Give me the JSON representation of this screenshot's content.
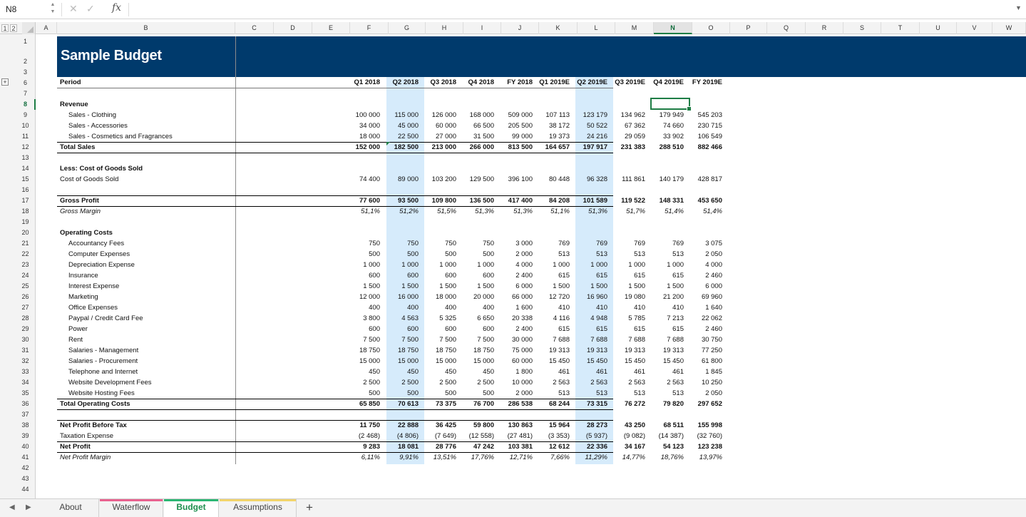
{
  "formula_bar": {
    "name_box": "N8",
    "formula": "",
    "fx": "fx",
    "cancel": "✕",
    "confirm": "✓"
  },
  "outline_levels": [
    "1",
    "2"
  ],
  "columns": [
    "A",
    "B",
    "C",
    "D",
    "E",
    "F",
    "G",
    "H",
    "I",
    "J",
    "K",
    "L",
    "M",
    "N",
    "O",
    "P",
    "Q",
    "R",
    "S",
    "T",
    "U",
    "V",
    "W"
  ],
  "active_column": "N",
  "rows": [
    "1",
    "2",
    "3",
    "6",
    "7",
    "8",
    "9",
    "10",
    "11",
    "12",
    "13",
    "14",
    "15",
    "16",
    "17",
    "18",
    "19",
    "20",
    "21",
    "22",
    "23",
    "24",
    "25",
    "26",
    "27",
    "28",
    "29",
    "30",
    "31",
    "32",
    "33",
    "34",
    "35",
    "36",
    "37",
    "38",
    "39",
    "40",
    "41",
    "42",
    "43",
    "44"
  ],
  "active_row": "8",
  "sheet": {
    "title": "Sample Budget",
    "period_label": "Period",
    "periods": [
      "Q1 2018",
      "Q2 2018",
      "Q3 2018",
      "Q4 2018",
      "FY 2018",
      "Q1 2019E",
      "Q2 2019E",
      "Q3 2019E",
      "Q4 2019E",
      "FY 2019E"
    ],
    "lines": [
      {
        "row": "8",
        "label": "Revenue",
        "bold": true
      },
      {
        "row": "9",
        "label": "Sales - Clothing",
        "indent": true,
        "values": [
          "100 000",
          "115 000",
          "126 000",
          "168 000",
          "509 000",
          "107 113",
          "123 179",
          "134 962",
          "179 949",
          "545 203"
        ]
      },
      {
        "row": "10",
        "label": "Sales - Accessories",
        "indent": true,
        "values": [
          "34 000",
          "45 000",
          "60 000",
          "66 500",
          "205 500",
          "38 172",
          "50 522",
          "67 362",
          "74 660",
          "230 715"
        ]
      },
      {
        "row": "11",
        "label": "Sales - Cosmetics and Fragrances",
        "indent": true,
        "values": [
          "18 000",
          "22 500",
          "27 000",
          "31 500",
          "99 000",
          "19 373",
          "24 216",
          "29 059",
          "33 902",
          "106 549"
        ]
      },
      {
        "row": "12",
        "label": "Total Sales",
        "bold": true,
        "values": [
          "152 000",
          "182 500",
          "213 000",
          "266 000",
          "813 500",
          "164 657",
          "197 917",
          "231 383",
          "288 510",
          "882 466"
        ]
      },
      {
        "row": "14",
        "label": "Less: Cost of Goods Sold",
        "bold": true
      },
      {
        "row": "15",
        "label": "Cost of Goods Sold",
        "values": [
          "74 400",
          "89 000",
          "103 200",
          "129 500",
          "396 100",
          "80 448",
          "96 328",
          "111 861",
          "140 179",
          "428 817"
        ]
      },
      {
        "row": "17",
        "label": "Gross Profit",
        "bold": true,
        "values": [
          "77 600",
          "93 500",
          "109 800",
          "136 500",
          "417 400",
          "84 208",
          "101 589",
          "119 522",
          "148 331",
          "453 650"
        ]
      },
      {
        "row": "18",
        "label": "Gross Margin",
        "italic": true,
        "values": [
          "51,1%",
          "51,2%",
          "51,5%",
          "51,3%",
          "51,3%",
          "51,1%",
          "51,3%",
          "51,7%",
          "51,4%",
          "51,4%"
        ]
      },
      {
        "row": "20",
        "label": "Operating Costs",
        "bold": true
      },
      {
        "row": "21",
        "label": "Accountancy Fees",
        "indent": true,
        "values": [
          "750",
          "750",
          "750",
          "750",
          "3 000",
          "769",
          "769",
          "769",
          "769",
          "3 075"
        ]
      },
      {
        "row": "22",
        "label": "Computer Expenses",
        "indent": true,
        "values": [
          "500",
          "500",
          "500",
          "500",
          "2 000",
          "513",
          "513",
          "513",
          "513",
          "2 050"
        ]
      },
      {
        "row": "23",
        "label": "Depreciation Expense",
        "indent": true,
        "values": [
          "1 000",
          "1 000",
          "1 000",
          "1 000",
          "4 000",
          "1 000",
          "1 000",
          "1 000",
          "1 000",
          "4 000"
        ]
      },
      {
        "row": "24",
        "label": "Insurance",
        "indent": true,
        "values": [
          "600",
          "600",
          "600",
          "600",
          "2 400",
          "615",
          "615",
          "615",
          "615",
          "2 460"
        ]
      },
      {
        "row": "25",
        "label": "Interest Expense",
        "indent": true,
        "values": [
          "1 500",
          "1 500",
          "1 500",
          "1 500",
          "6 000",
          "1 500",
          "1 500",
          "1 500",
          "1 500",
          "6 000"
        ]
      },
      {
        "row": "26",
        "label": "Marketing",
        "indent": true,
        "values": [
          "12 000",
          "16 000",
          "18 000",
          "20 000",
          "66 000",
          "12 720",
          "16 960",
          "19 080",
          "21 200",
          "69 960"
        ]
      },
      {
        "row": "27",
        "label": "Office Expenses",
        "indent": true,
        "values": [
          "400",
          "400",
          "400",
          "400",
          "1 600",
          "410",
          "410",
          "410",
          "410",
          "1 640"
        ]
      },
      {
        "row": "28",
        "label": "Paypal / Credit Card Fee",
        "indent": true,
        "values": [
          "3 800",
          "4 563",
          "5 325",
          "6 650",
          "20 338",
          "4 116",
          "4 948",
          "5 785",
          "7 213",
          "22 062"
        ]
      },
      {
        "row": "29",
        "label": "Power",
        "indent": true,
        "values": [
          "600",
          "600",
          "600",
          "600",
          "2 400",
          "615",
          "615",
          "615",
          "615",
          "2 460"
        ]
      },
      {
        "row": "30",
        "label": "Rent",
        "indent": true,
        "values": [
          "7 500",
          "7 500",
          "7 500",
          "7 500",
          "30 000",
          "7 688",
          "7 688",
          "7 688",
          "7 688",
          "30 750"
        ]
      },
      {
        "row": "31",
        "label": "Salaries - Management",
        "indent": true,
        "values": [
          "18 750",
          "18 750",
          "18 750",
          "18 750",
          "75 000",
          "19 313",
          "19 313",
          "19 313",
          "19 313",
          "77 250"
        ]
      },
      {
        "row": "32",
        "label": "Salaries - Procurement",
        "indent": true,
        "values": [
          "15 000",
          "15 000",
          "15 000",
          "15 000",
          "60 000",
          "15 450",
          "15 450",
          "15 450",
          "15 450",
          "61 800"
        ]
      },
      {
        "row": "33",
        "label": "Telephone and Internet",
        "indent": true,
        "values": [
          "450",
          "450",
          "450",
          "450",
          "1 800",
          "461",
          "461",
          "461",
          "461",
          "1 845"
        ]
      },
      {
        "row": "34",
        "label": "Website Development Fees",
        "indent": true,
        "values": [
          "2 500",
          "2 500",
          "2 500",
          "2 500",
          "10 000",
          "2 563",
          "2 563",
          "2 563",
          "2 563",
          "10 250"
        ]
      },
      {
        "row": "35",
        "label": "Website Hosting Fees",
        "indent": true,
        "values": [
          "500",
          "500",
          "500",
          "500",
          "2 000",
          "513",
          "513",
          "513",
          "513",
          "2 050"
        ]
      },
      {
        "row": "36",
        "label": "Total Operating Costs",
        "bold": true,
        "values": [
          "65 850",
          "70 613",
          "73 375",
          "76 700",
          "286 538",
          "68 244",
          "73 315",
          "76 272",
          "79 820",
          "297 652"
        ]
      },
      {
        "row": "38",
        "label": "Net Profit Before Tax",
        "bold": true,
        "values": [
          "11 750",
          "22 888",
          "36 425",
          "59 800",
          "130 863",
          "15 964",
          "28 273",
          "43 250",
          "68 511",
          "155 998"
        ]
      },
      {
        "row": "39",
        "label": "Taxation Expense",
        "values": [
          "(2 468)",
          "(4 806)",
          "(7 649)",
          "(12 558)",
          "(27 481)",
          "(3 353)",
          "(5 937)",
          "(9 082)",
          "(14 387)",
          "(32 760)"
        ]
      },
      {
        "row": "40",
        "label": "Net Profit",
        "bold": true,
        "values": [
          "9 283",
          "18 081",
          "28 776",
          "47 242",
          "103 381",
          "12 612",
          "22 336",
          "34 167",
          "54 123",
          "123 238"
        ]
      },
      {
        "row": "41",
        "label": "Net Profit Margin",
        "italic": true,
        "values": [
          "6,11%",
          "9,91%",
          "13,51%",
          "17,76%",
          "12,71%",
          "7,66%",
          "11,29%",
          "14,77%",
          "18,76%",
          "13,97%"
        ]
      }
    ]
  },
  "tabs": [
    {
      "label": "About",
      "color": ""
    },
    {
      "label": "Waterflow",
      "color": "#e8628f"
    },
    {
      "label": "Budget",
      "color": "#2bb673",
      "active": true
    },
    {
      "label": "Assumptions",
      "color": "#f2d46b"
    }
  ],
  "add_sheet": "+"
}
